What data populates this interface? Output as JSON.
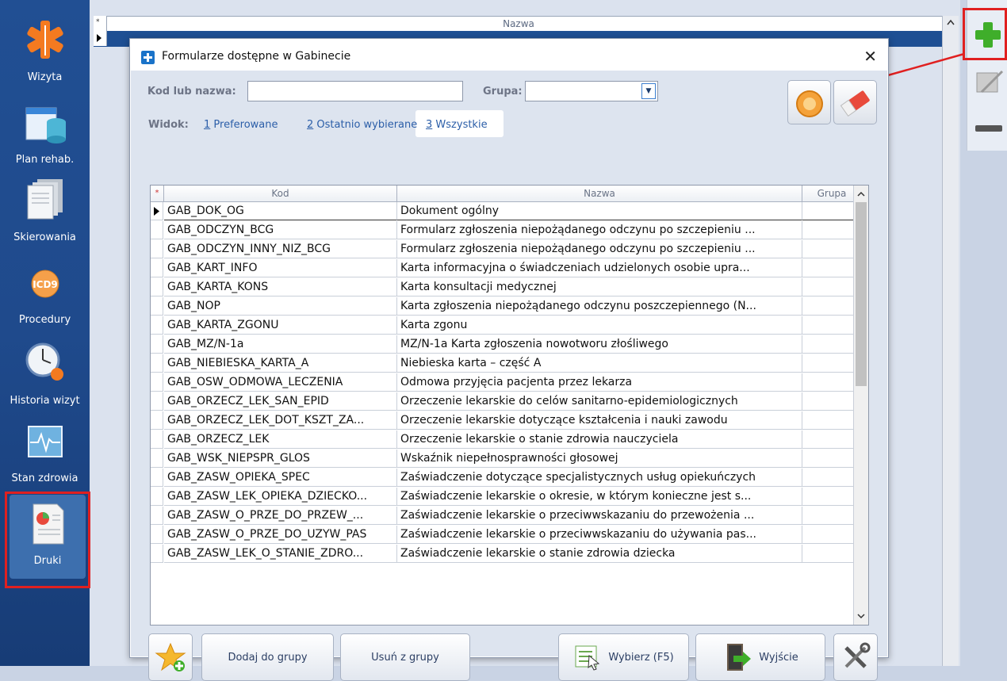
{
  "sidebar": {
    "items": [
      {
        "label": "Wizyta",
        "icon": "caduceus-icon"
      },
      {
        "label": "Plan rehab.",
        "icon": "calendar-database-icon"
      },
      {
        "label": "Skierowania",
        "icon": "documents-icon"
      },
      {
        "label": "Procedury",
        "icon": "icd9-icon"
      },
      {
        "label": "Historia wizyt",
        "icon": "clock-history-icon"
      },
      {
        "label": "Stan zdrowia",
        "icon": "heart-monitor-icon"
      },
      {
        "label": "Druki",
        "icon": "print-document-icon"
      }
    ]
  },
  "background": {
    "column_header": "Nazwa"
  },
  "dialog": {
    "title": "Formularze dostępne w Gabinecie",
    "search_label": "Kod lub nazwa:",
    "search_value": "",
    "group_label": "Grupa:",
    "group_value": "",
    "view_label": "Widok:",
    "views": [
      {
        "key": "1",
        "label": "Preferowane"
      },
      {
        "key": "2",
        "label": "Ostatnio wybierane"
      },
      {
        "key": "3",
        "label": "Wszystkie"
      }
    ],
    "active_view": "3",
    "table": {
      "columns": [
        "Kod",
        "Nazwa",
        "Grupa"
      ],
      "rows": [
        {
          "kod": "GAB_DOK_OG",
          "nazwa": "Dokument ogólny",
          "grupa": ""
        },
        {
          "kod": "GAB_ODCZYN_BCG",
          "nazwa": "Formularz zgłoszenia niepożądanego odczynu po szczepieniu ...",
          "grupa": ""
        },
        {
          "kod": "GAB_ODCZYN_INNY_NIZ_BCG",
          "nazwa": "Formularz zgłoszenia niepożądanego odczynu po szczepieniu ...",
          "grupa": ""
        },
        {
          "kod": "GAB_KART_INFO",
          "nazwa": "Karta informacyjna o świadczeniach udzielonych osobie upra...",
          "grupa": ""
        },
        {
          "kod": "GAB_KARTA_KONS",
          "nazwa": "Karta konsultacji medycznej",
          "grupa": ""
        },
        {
          "kod": "GAB_NOP",
          "nazwa": "Karta zgłoszenia niepożądanego odczynu poszczepiennego (N...",
          "grupa": ""
        },
        {
          "kod": "GAB_KARTA_ZGONU",
          "nazwa": "Karta zgonu",
          "grupa": ""
        },
        {
          "kod": "GAB_MZ/N-1a",
          "nazwa": "MZ/N-1a Karta zgłoszenia nowotworu złośliwego",
          "grupa": ""
        },
        {
          "kod": "GAB_NIEBIESKA_KARTA_A",
          "nazwa": "Niebieska karta – część A",
          "grupa": ""
        },
        {
          "kod": "GAB_OSW_ODMOWA_LECZENIA",
          "nazwa": "Odmowa przyjęcia pacjenta przez lekarza",
          "grupa": ""
        },
        {
          "kod": "GAB_ORZECZ_LEK_SAN_EPID",
          "nazwa": "Orzeczenie lekarskie do celów sanitarno-epidemiologicznych",
          "grupa": ""
        },
        {
          "kod": "GAB_ORZECZ_LEK_DOT_KSZT_ZA...",
          "nazwa": "Orzeczenie lekarskie dotyczące kształcenia i nauki zawodu",
          "grupa": ""
        },
        {
          "kod": "GAB_ORZECZ_LEK",
          "nazwa": "Orzeczenie lekarskie o stanie zdrowia nauczyciela",
          "grupa": ""
        },
        {
          "kod": "GAB_WSK_NIEPSPR_GLOS",
          "nazwa": "Wskaźnik niepełnosprawności głosowej",
          "grupa": ""
        },
        {
          "kod": "GAB_ZASW_OPIEKA_SPEC",
          "nazwa": "Zaświadczenie dotyczące specjalistycznych usług opiekuńczych",
          "grupa": ""
        },
        {
          "kod": "GAB_ZASW_LEK_OPIEKA_DZIECKO...",
          "nazwa": "Zaświadczenie lekarskie o okresie, w którym konieczne jest s...",
          "grupa": ""
        },
        {
          "kod": "GAB_ZASW_O_PRZE_DO_PRZEW_...",
          "nazwa": "Zaświadczenie lekarskie o przeciwwskazaniu do przewożenia ...",
          "grupa": ""
        },
        {
          "kod": "GAB_ZASW_O_PRZE_DO_UZYW_PAS",
          "nazwa": "Zaświadczenie lekarskie o przeciwwskazaniu do używania pas...",
          "grupa": ""
        },
        {
          "kod": "GAB_ZASW_LEK_O_STANIE_ZDRO...",
          "nazwa": "Zaświadczenie lekarskie o stanie zdrowia dziecka",
          "grupa": ""
        }
      ]
    },
    "buttons": {
      "add_to_group": "Dodaj do grupy",
      "remove_from_group": "Usuń z grupy",
      "choose": "Wybierz (F5)",
      "exit": "Wyjście"
    }
  },
  "colors": {
    "accent": "#1e4f93",
    "highlight": "#e02020",
    "sidebar": "#214f93"
  }
}
